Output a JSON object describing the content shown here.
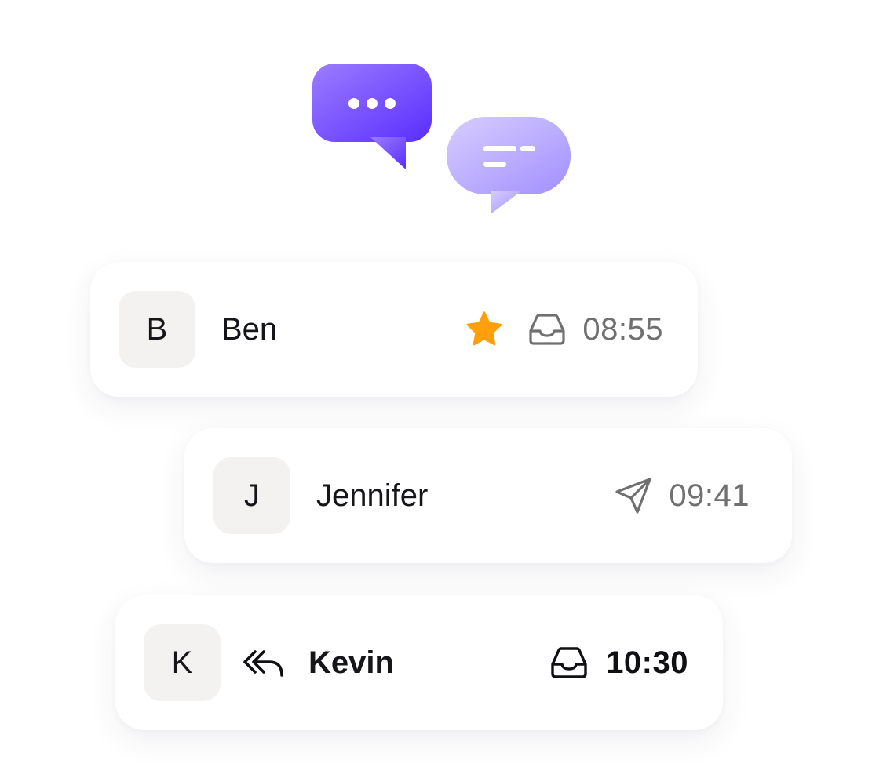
{
  "colors": {
    "star": "#ff9f0a",
    "icon_gray": "#707070",
    "icon_dark": "#101014",
    "avatar_bg": "#f3f2f1",
    "bubble_primary": "#6a3bff",
    "bubble_secondary": "#b8a8ff"
  },
  "hero": {
    "icons": [
      "chat-bubble-dots-icon",
      "chat-bubble-lines-icon"
    ]
  },
  "messages": [
    {
      "initial": "B",
      "name": "Ben",
      "time": "08:55",
      "starred": true,
      "status_icon": "inbox-icon",
      "unread": false
    },
    {
      "initial": "J",
      "name": "Jennifer",
      "time": "09:41",
      "starred": false,
      "status_icon": "send-icon",
      "unread": false
    },
    {
      "initial": "K",
      "name": "Kevin",
      "time": "10:30",
      "starred": false,
      "status_icon": "inbox-icon",
      "leading_icon": "reply-all-icon",
      "unread": true
    }
  ]
}
